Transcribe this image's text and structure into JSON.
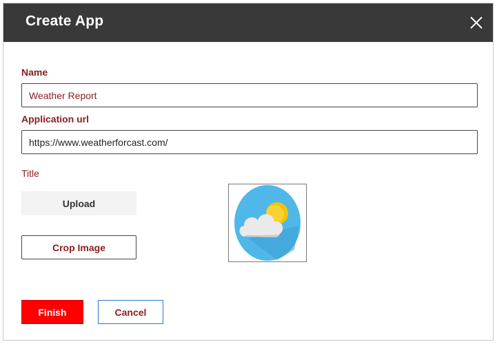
{
  "dialog": {
    "title": "Create App",
    "close_icon": "close-icon"
  },
  "form": {
    "name_label": "Name",
    "name_value": "Weather Report",
    "url_label": "Application url",
    "url_value": "https://www.weatherforcast.com/",
    "title_label": "Title"
  },
  "actions": {
    "upload_label": "Upload",
    "crop_label": "Crop Image",
    "finish_label": "Finish",
    "cancel_label": "Cancel"
  },
  "preview": {
    "icon": "weather-cloud-sun-icon"
  },
  "colors": {
    "titlebar": "#393939",
    "label": "#8b1d1d",
    "finish": "#ff0000",
    "cancel_border": "#2b78c5",
    "icon_circle": "#4fb8e8",
    "sun": "#f5c400",
    "cloud": "#eaeaea"
  }
}
